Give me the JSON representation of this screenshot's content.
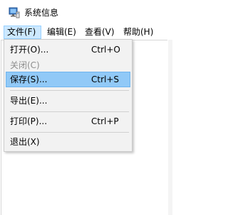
{
  "window": {
    "title": "系统信息",
    "icon": "system-info-icon"
  },
  "menubar": {
    "items": [
      {
        "label": "文件(F)",
        "active": true
      },
      {
        "label": "编辑(E)",
        "active": false
      },
      {
        "label": "查看(V)",
        "active": false
      },
      {
        "label": "帮助(H)",
        "active": false
      }
    ]
  },
  "file_menu": {
    "items": [
      {
        "label": "打开(O)...",
        "shortcut": "Ctrl+O",
        "disabled": false,
        "highlighted": false
      },
      {
        "label": "关闭(C)",
        "shortcut": "",
        "disabled": true,
        "highlighted": false
      },
      {
        "label": "保存(S)...",
        "shortcut": "Ctrl+S",
        "disabled": false,
        "highlighted": true
      },
      {
        "label": "导出(E)...",
        "shortcut": "",
        "disabled": false,
        "highlighted": false
      },
      {
        "label": "打印(P)...",
        "shortcut": "Ctrl+P",
        "disabled": false,
        "highlighted": false
      },
      {
        "label": "退出(X)",
        "shortcut": "",
        "disabled": false,
        "highlighted": false
      }
    ]
  },
  "colors": {
    "highlight": "#91c9f7",
    "menu_background": "#f2f2f2",
    "active_menubar": "#cce8ff",
    "disabled_text": "#8d8d8d"
  }
}
